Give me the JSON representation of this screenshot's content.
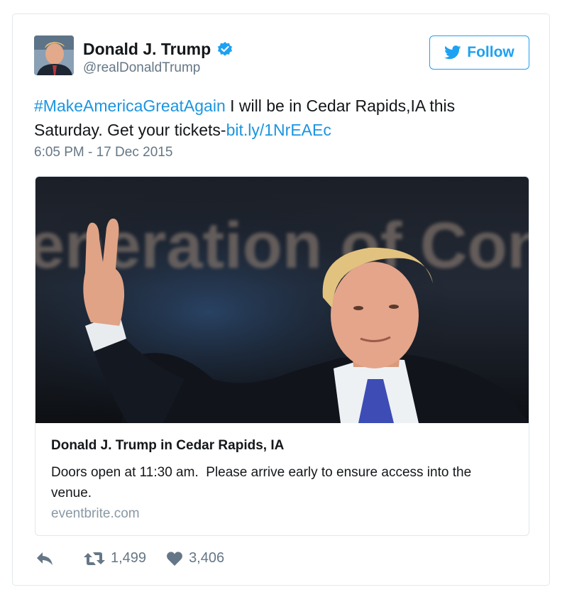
{
  "author": {
    "display_name": "Donald J. Trump",
    "handle": "@realDonaldTrump",
    "verified": true
  },
  "follow_button": {
    "label": "Follow",
    "icon": "twitter-bird-icon"
  },
  "tweet": {
    "hashtag": "#MakeAmericaGreatAgain",
    "text_part1": " I will be in Cedar Rapids,IA this Saturday. Get your tickets-",
    "link": "bit.ly/1NrEAEc",
    "timestamp": "6:05 PM - 17 Dec 2015"
  },
  "media_card": {
    "image_banner_text": "eneration of Conse",
    "title": "Donald J. Trump in Cedar Rapids, IA",
    "description": "Doors open at 11:30 am.  Please arrive early to ensure access into the venue.",
    "domain": "eventbrite.com"
  },
  "actions": {
    "reply_icon": "reply-icon",
    "retweet_icon": "retweet-icon",
    "retweet_count": "1,499",
    "like_icon": "heart-icon",
    "like_count": "3,406"
  },
  "colors": {
    "link": "#1b95e0",
    "accent": "#1da1f2",
    "secondary_text": "#657786"
  }
}
